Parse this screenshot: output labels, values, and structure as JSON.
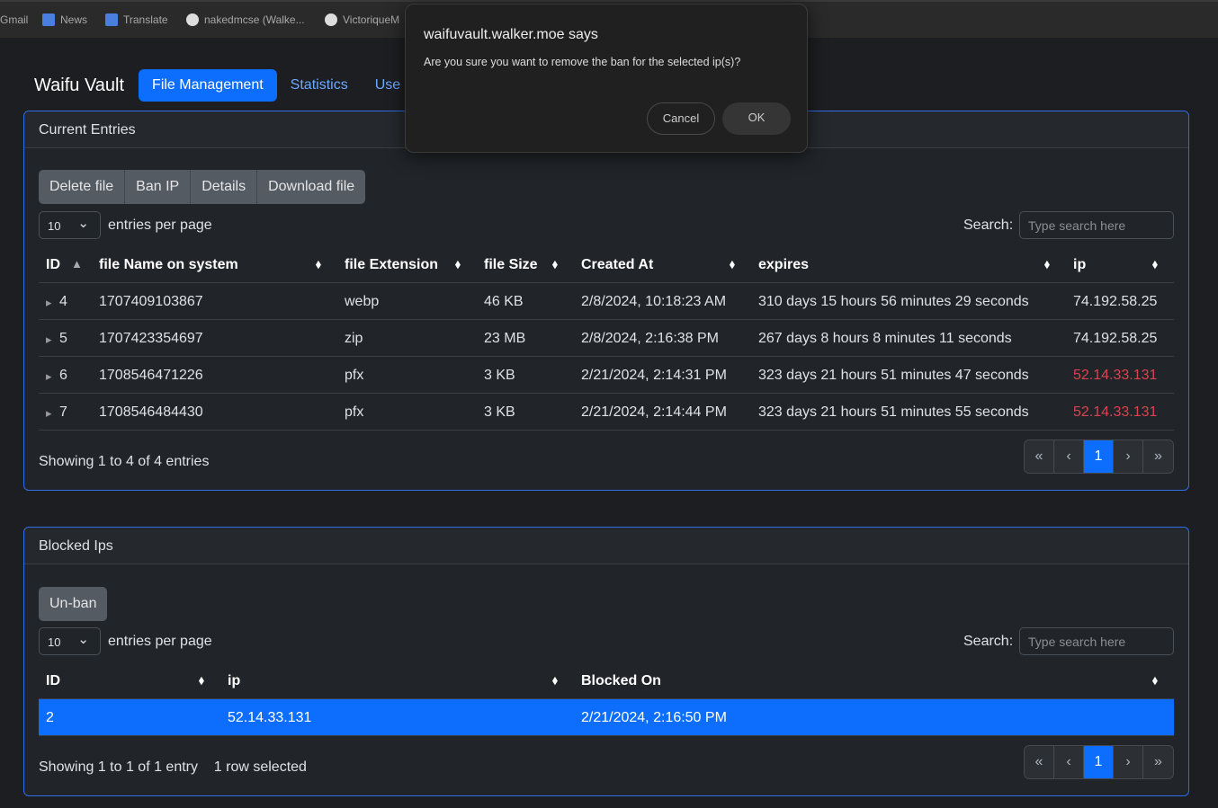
{
  "bookmarks": [
    "Gmail",
    "News",
    "Translate",
    "nakedmcse (Walke...",
    "VictoriqueM"
  ],
  "nav": {
    "brand": "Waifu Vault",
    "items": [
      "File Management",
      "Statistics",
      "Use"
    ]
  },
  "dialog": {
    "title": "waifuvault.walker.moe says",
    "message": "Are you sure you want to remove the ban for the selected ip(s)?",
    "cancel": "Cancel",
    "ok": "OK"
  },
  "entries": {
    "title": "Current Entries",
    "buttons": [
      "Delete file",
      "Ban IP",
      "Details",
      "Download file"
    ],
    "page_size": "10",
    "entries_label": "entries per page",
    "search_label": "Search:",
    "search_placeholder": "Type search here",
    "columns": [
      "ID",
      "file Name on system",
      "file Extension",
      "file Size",
      "Created At",
      "expires",
      "ip"
    ],
    "rows": [
      {
        "id": "4",
        "name": "1707409103867",
        "ext": "webp",
        "size": "46 KB",
        "created": "2/8/2024, 10:18:23 AM",
        "expires": "310 days 15 hours 56 minutes 29 seconds",
        "ip": "74.192.58.25",
        "banned": false
      },
      {
        "id": "5",
        "name": "1707423354697",
        "ext": "zip",
        "size": "23 MB",
        "created": "2/8/2024, 2:16:38 PM",
        "expires": "267 days 8 hours 8 minutes 11 seconds",
        "ip": "74.192.58.25",
        "banned": false
      },
      {
        "id": "6",
        "name": "1708546471226",
        "ext": "pfx",
        "size": "3 KB",
        "created": "2/21/2024, 2:14:31 PM",
        "expires": "323 days 21 hours 51 minutes 47 seconds",
        "ip": "52.14.33.131",
        "banned": true
      },
      {
        "id": "7",
        "name": "1708546484430",
        "ext": "pfx",
        "size": "3 KB",
        "created": "2/21/2024, 2:14:44 PM",
        "expires": "323 days 21 hours 51 minutes 55 seconds",
        "ip": "52.14.33.131",
        "banned": true
      }
    ],
    "info": "Showing 1 to 4 of 4 entries"
  },
  "blocked": {
    "title": "Blocked Ips",
    "button": "Un-ban",
    "page_size": "10",
    "entries_label": "entries per page",
    "search_label": "Search:",
    "search_placeholder": "Type search here",
    "columns": [
      "ID",
      "ip",
      "Blocked On"
    ],
    "rows": [
      {
        "id": "2",
        "ip": "52.14.33.131",
        "blocked_on": "2/21/2024, 2:16:50 PM",
        "selected": true
      }
    ],
    "info": "Showing 1 to 1 of 1 entry",
    "selected_info": "1 row selected"
  },
  "pagination": {
    "first": "«",
    "prev": "‹",
    "current": "1",
    "next": "›",
    "last": "»"
  },
  "colors": {
    "accent": "#0d6efd",
    "banned": "#d9434f"
  }
}
